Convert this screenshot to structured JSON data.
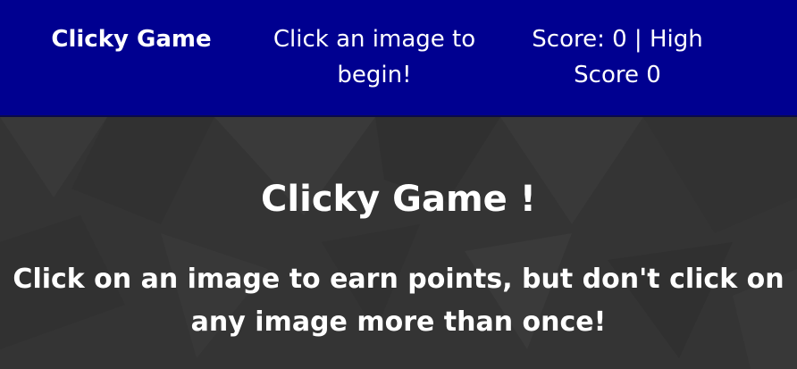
{
  "navbar": {
    "brand": "Clicky Game",
    "message": "Click an image to begin!",
    "score_text": "Score: 0 | High Score 0"
  },
  "hero": {
    "title": "Clicky Game !",
    "subtitle": "Click on an image to earn points, but don't click on any image more than once!"
  },
  "colors": {
    "navbar_bg": "#000090",
    "hero_bg": "#343434",
    "text": "#ffffff"
  }
}
